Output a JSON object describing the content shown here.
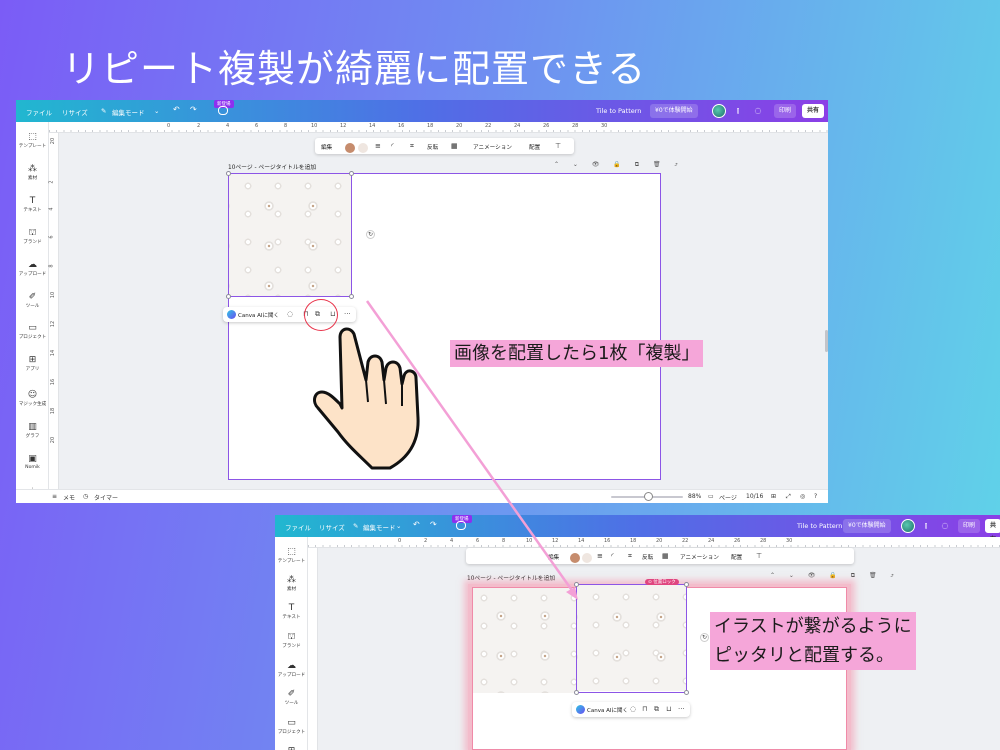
{
  "title": "リピート複製が綺麗に配置できる",
  "canva": {
    "menu_file": "ファイル",
    "menu_resize": "リサイズ",
    "edit_mode": "編集モード",
    "new_badge": "新登場",
    "doc_title": "Tile to Pattern",
    "try_free": "¥0で体験開始",
    "print": "印刷",
    "share": "共有",
    "sidebar": [
      {
        "label": "テンプレート",
        "icon": "layout-icon"
      },
      {
        "label": "素材",
        "icon": "elements-icon"
      },
      {
        "label": "テキスト",
        "icon": "text-icon"
      },
      {
        "label": "ブランド",
        "icon": "brand-icon"
      },
      {
        "label": "アップロード",
        "icon": "upload-icon"
      },
      {
        "label": "ツール",
        "icon": "tools-icon"
      },
      {
        "label": "プロジェクト",
        "icon": "folder-icon"
      },
      {
        "label": "アプリ",
        "icon": "apps-icon"
      },
      {
        "label": "マジック生成",
        "icon": "magic-icon"
      },
      {
        "label": "グラフ",
        "icon": "chart-icon"
      },
      {
        "label": "Nomik",
        "icon": "nomik-icon"
      }
    ],
    "ruler_top": [
      "0",
      "2",
      "4",
      "6",
      "8",
      "10",
      "12",
      "14",
      "16",
      "18",
      "20",
      "22",
      "24",
      "26",
      "28",
      "30"
    ],
    "ruler_left": [
      "20",
      "2",
      "4",
      "6",
      "8",
      "10",
      "12",
      "14",
      "16",
      "18",
      "20"
    ],
    "toolbar": {
      "edit": "編集",
      "flip": "反転",
      "animation": "アニメーション",
      "position": "配置",
      "color1": "#c68c6d",
      "color2": "#efe6e0"
    },
    "page_label": "10ページ - ページタイトルを追加",
    "page_ctrl_icons": "⌃ ⌄ 👁 🔒 ⧉ 🗑 ⤴",
    "float_bar": {
      "ai_label": "Canva AIに聞く",
      "more": "···"
    },
    "bottom": {
      "notes": "メモ",
      "timer": "タイマー",
      "zoom": "88%",
      "pages": "ページ",
      "page_count": "10/16"
    },
    "lock_tag": "⊙ 位置ロック"
  },
  "callouts": {
    "first": "画像を配置したら1枚「複製」",
    "second_line1": "イラストが繋がるように",
    "second_line2": "ピッタリと配置する。"
  },
  "colors": {
    "accent_purple": "#8c55e6",
    "callout_pink": "#f5a6d9",
    "ring_red": "#e8334a",
    "arrow_pink": "#f3a0d6"
  }
}
